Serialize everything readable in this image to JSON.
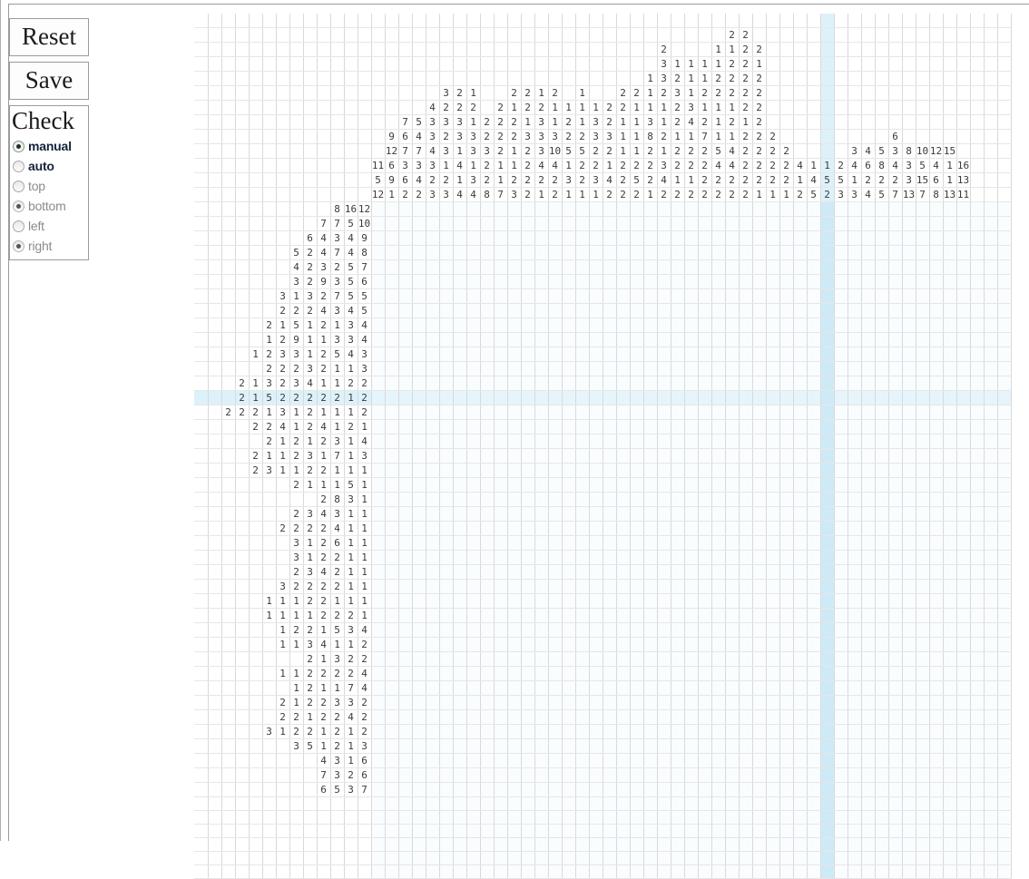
{
  "window": {
    "title": ""
  },
  "controls": {
    "reset_label": "Reset",
    "save_label": "Save",
    "check_title": "Check",
    "options": [
      {
        "label": "manual",
        "state": "selected",
        "icon": "radio-selected-icon"
      },
      {
        "label": "auto",
        "state": "unselected",
        "icon": "radio-unselected-icon"
      },
      {
        "label": "top",
        "state": "disabled",
        "icon": "radio-unselected-icon"
      },
      {
        "label": "bottom",
        "state": "disabled-sel",
        "icon": "radio-selected-icon"
      },
      {
        "label": "left",
        "state": "disabled",
        "icon": "radio-unselected-icon"
      },
      {
        "label": "right",
        "state": "disabled-sel",
        "icon": "radio-selected-icon"
      }
    ]
  },
  "colors": {
    "highlight": "#cfeaf7",
    "grid_line": "#cfcfcf",
    "grid_major": "#4a4a4a",
    "clue_text": "#3a3a3a",
    "cell_bg": "#fafdff"
  },
  "puzzle": {
    "cell_size": 15,
    "columns": 47,
    "rows": 47,
    "row_clue_slots": 13,
    "col_clue_slots": 13,
    "highlight_col_index": 33,
    "highlight_row_index": 13,
    "column_clues": [
      [
        11,
        5,
        12
      ],
      [
        9,
        12,
        6,
        9,
        1
      ],
      [
        7,
        6,
        7,
        3,
        6,
        2
      ],
      [
        5,
        4,
        7,
        3,
        4,
        2
      ],
      [
        4,
        3,
        3,
        4,
        3,
        2,
        3
      ],
      [
        3,
        2,
        3,
        2,
        3,
        1,
        2,
        3
      ],
      [
        2,
        2,
        3,
        3,
        1,
        4,
        1,
        4
      ],
      [
        1,
        2,
        1,
        3,
        3,
        1,
        3,
        4
      ],
      [
        2,
        2,
        3,
        2,
        2,
        8
      ],
      [
        2,
        2,
        2,
        2,
        1,
        1,
        7
      ],
      [
        2,
        1,
        2,
        2,
        1,
        1,
        2,
        3
      ],
      [
        2,
        2,
        1,
        3,
        2,
        2,
        2,
        2
      ],
      [
        1,
        2,
        3,
        3,
        3,
        4,
        2,
        1
      ],
      [
        2,
        1,
        1,
        3,
        10,
        4,
        2,
        2
      ],
      [
        1,
        2,
        2,
        5,
        1,
        3,
        1
      ],
      [
        1,
        1,
        1,
        2,
        5,
        2,
        2,
        1
      ],
      [
        1,
        3,
        3,
        2,
        2,
        3,
        1
      ],
      [
        2,
        2,
        3,
        2,
        1,
        4,
        2
      ],
      [
        2,
        2,
        1,
        1,
        1,
        2,
        2,
        2
      ],
      [
        2,
        1,
        1,
        1,
        1,
        2,
        5,
        2
      ],
      [
        1,
        1,
        1,
        3,
        8,
        2,
        2,
        2,
        1
      ],
      [
        2,
        3,
        3,
        2,
        1,
        1,
        2,
        1,
        3,
        4,
        2
      ],
      [
        1,
        2,
        3,
        2,
        2,
        1,
        2,
        2,
        1,
        2
      ],
      [
        1,
        1,
        1,
        3,
        4,
        1,
        2,
        2,
        1,
        2
      ],
      [
        1,
        1,
        2,
        1,
        2,
        7,
        2,
        2,
        2,
        2
      ],
      [
        1,
        1,
        2,
        2,
        1,
        1,
        1,
        5,
        4,
        2,
        2
      ],
      [
        2,
        1,
        2,
        2,
        2,
        1,
        2,
        1,
        4,
        4,
        2,
        2
      ],
      [
        2,
        2,
        2,
        2,
        2,
        2,
        1,
        2,
        2,
        2,
        2,
        2
      ],
      [
        2,
        1,
        2,
        2,
        2,
        2,
        2,
        2,
        2,
        2,
        1
      ],
      [
        2,
        2,
        2,
        2,
        1
      ],
      [
        2,
        2,
        2,
        1
      ],
      [
        4,
        1,
        2
      ],
      [
        1,
        4,
        5
      ],
      [
        1,
        5,
        2
      ],
      [
        2,
        5,
        3
      ],
      [
        3,
        4,
        1,
        3
      ],
      [
        4,
        6,
        2,
        4
      ],
      [
        5,
        8,
        2,
        5
      ],
      [
        6,
        3,
        4,
        2,
        7
      ],
      [
        8,
        3,
        3,
        13
      ],
      [
        10,
        5,
        15,
        7
      ],
      [
        12,
        4,
        6,
        8
      ],
      [
        15,
        1,
        1,
        13
      ],
      [
        16,
        13,
        11
      ]
    ],
    "row_clues": [
      [
        8,
        16,
        12
      ],
      [
        7,
        7,
        5,
        10
      ],
      [
        6,
        4,
        3,
        4,
        9
      ],
      [
        5,
        2,
        4,
        7,
        4,
        8
      ],
      [
        4,
        2,
        3,
        2,
        5,
        7
      ],
      [
        3,
        2,
        9,
        3,
        5,
        6
      ],
      [
        3,
        1,
        3,
        2,
        7,
        5,
        5
      ],
      [
        2,
        2,
        2,
        4,
        3,
        4,
        5
      ],
      [
        2,
        1,
        5,
        1,
        2,
        1,
        3,
        4
      ],
      [
        1,
        2,
        9,
        1,
        1,
        3,
        3,
        4
      ],
      [
        1,
        2,
        3,
        3,
        1,
        2,
        5,
        4,
        3
      ],
      [
        2,
        2,
        2,
        3,
        2,
        1,
        1,
        3
      ],
      [
        2,
        1,
        3,
        2,
        3,
        4,
        1,
        1,
        2,
        2
      ],
      [
        2,
        1,
        5,
        2,
        2,
        2,
        2,
        2,
        1,
        2
      ],
      [
        2,
        2,
        2,
        1,
        3,
        1,
        2,
        1,
        1,
        1,
        2
      ],
      [
        2,
        2,
        4,
        1,
        2,
        4,
        1,
        2,
        1
      ],
      [
        2,
        1,
        2,
        1,
        2,
        3,
        1,
        4
      ],
      [
        2,
        1,
        1,
        2,
        3,
        1,
        7,
        1,
        3
      ],
      [
        2,
        3,
        1,
        1,
        2,
        2,
        1,
        1,
        1
      ],
      [
        2,
        1,
        1,
        1,
        5,
        1
      ],
      [
        2,
        8,
        3,
        1
      ],
      [
        2,
        3,
        4,
        3,
        1,
        1
      ],
      [
        2,
        2,
        2,
        2,
        4,
        1,
        1
      ],
      [
        3,
        1,
        2,
        6,
        1,
        1
      ],
      [
        3,
        1,
        2,
        2,
        1,
        1
      ],
      [
        2,
        3,
        4,
        2,
        1,
        1
      ],
      [
        3,
        2,
        2,
        2,
        2,
        1,
        1
      ],
      [
        1,
        1,
        1,
        2,
        2,
        1,
        1,
        1
      ],
      [
        1,
        1,
        1,
        1,
        2,
        2,
        2,
        1
      ],
      [
        1,
        2,
        2,
        1,
        5,
        3,
        4
      ],
      [
        1,
        1,
        3,
        4,
        1,
        1,
        2
      ],
      [
        2,
        1,
        3,
        2,
        2
      ],
      [
        1,
        1,
        2,
        2,
        2,
        2,
        4
      ],
      [
        1,
        2,
        1,
        1,
        7,
        4
      ],
      [
        2,
        1,
        2,
        2,
        3,
        3,
        2
      ],
      [
        2,
        2,
        1,
        2,
        2,
        4,
        2
      ],
      [
        3,
        1,
        2,
        2,
        1,
        2,
        1,
        2
      ],
      [
        3,
        5,
        1,
        2,
        1,
        3
      ],
      [
        4,
        3,
        1,
        6
      ],
      [
        7,
        3,
        2,
        6
      ],
      [
        6,
        5,
        3,
        7
      ]
    ]
  }
}
